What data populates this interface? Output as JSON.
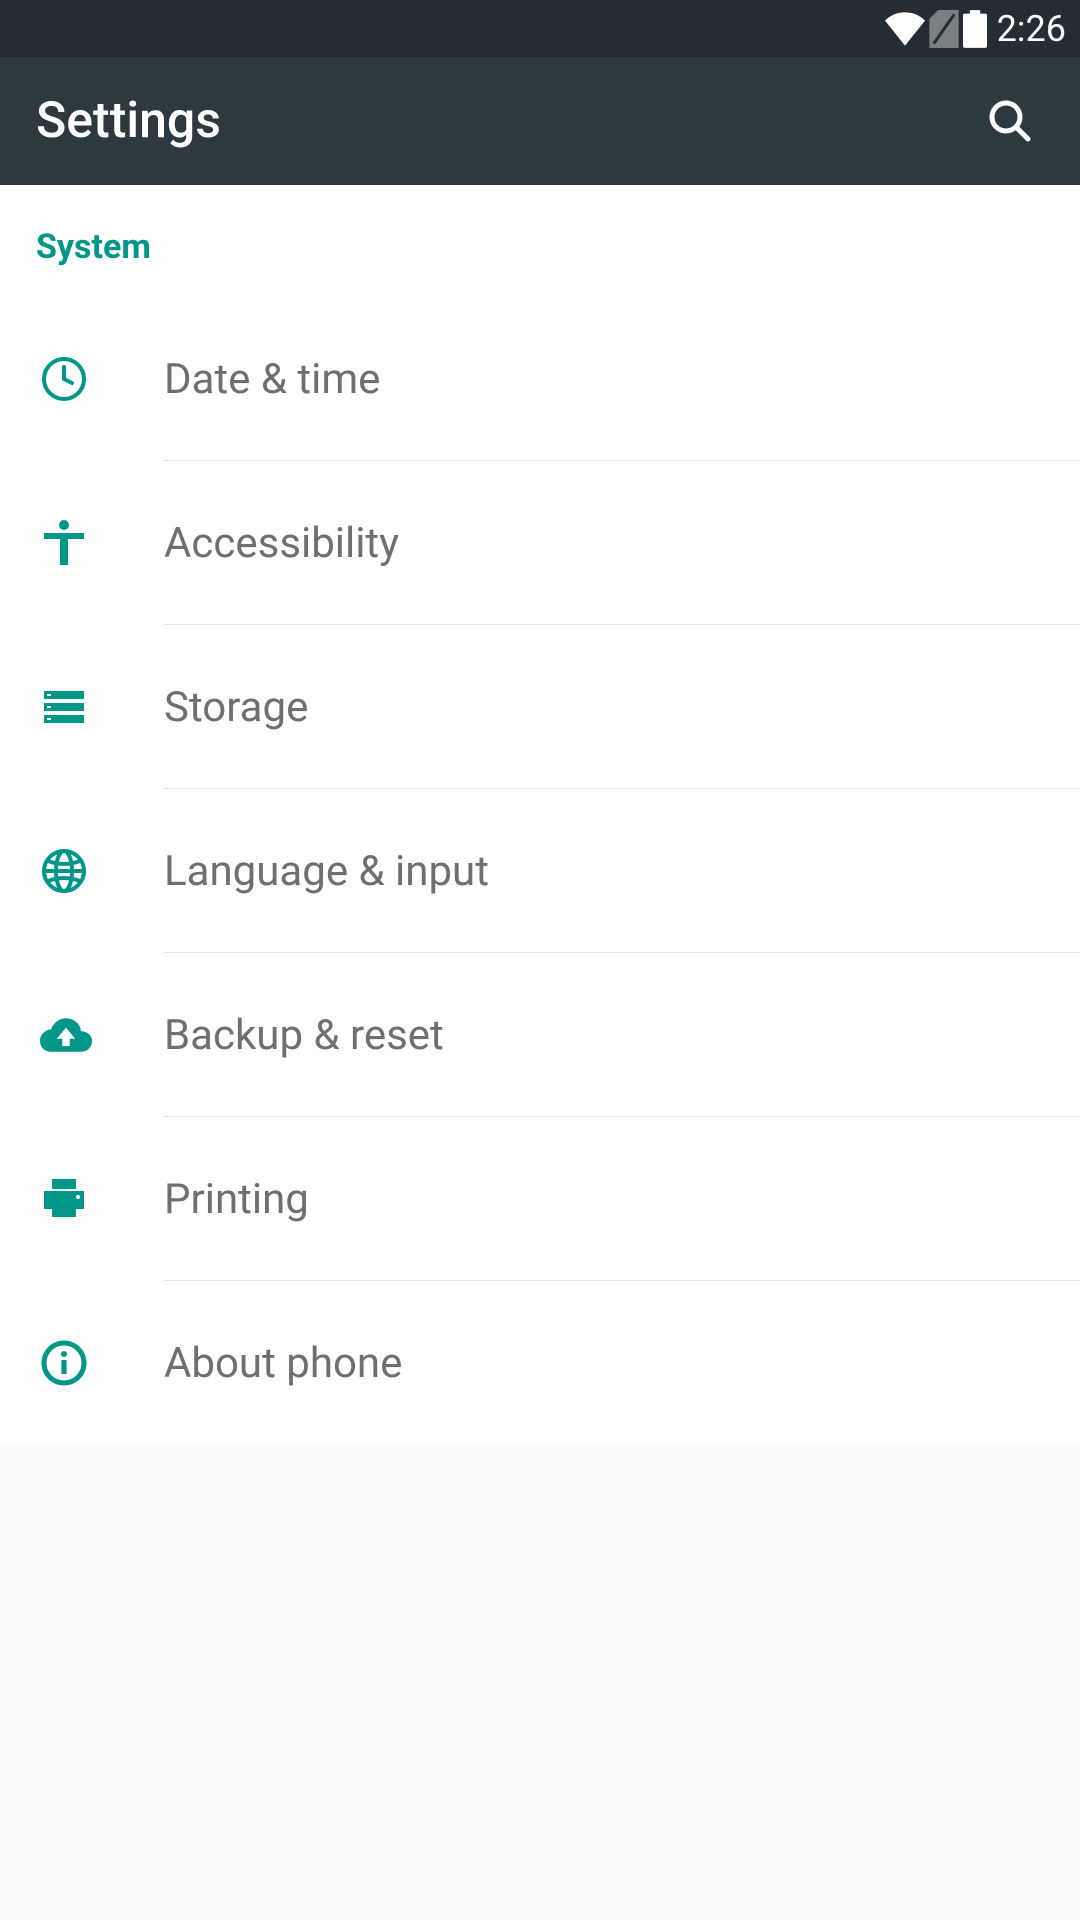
{
  "statusBar": {
    "time": "2:26"
  },
  "appBar": {
    "title": "Settings"
  },
  "section": {
    "header": "System",
    "items": [
      {
        "label": "Date & time",
        "icon": "clock"
      },
      {
        "label": "Accessibility",
        "icon": "accessibility"
      },
      {
        "label": "Storage",
        "icon": "storage"
      },
      {
        "label": "Language & input",
        "icon": "globe"
      },
      {
        "label": "Backup & reset",
        "icon": "cloud-upload"
      },
      {
        "label": "Printing",
        "icon": "printer"
      },
      {
        "label": "About phone",
        "icon": "info"
      }
    ]
  },
  "colors": {
    "accent": "#009688",
    "statusBar": "#232d33",
    "appBar": "#2c3a40",
    "itemText": "#6f6f6f"
  }
}
